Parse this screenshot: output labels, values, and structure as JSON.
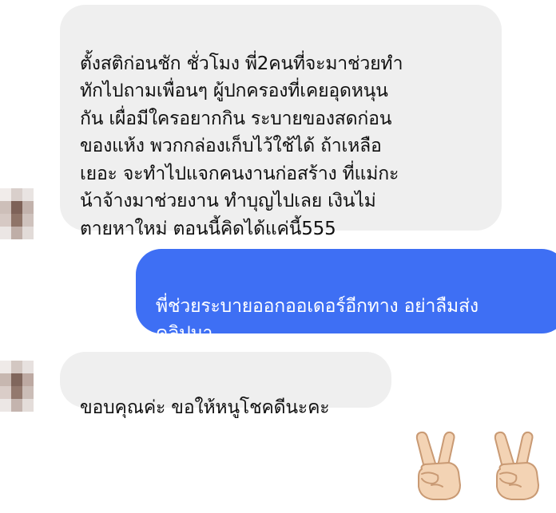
{
  "conversation": {
    "messages": [
      {
        "direction": "incoming",
        "text": "ตั้งสติก่อนชัก ชั่วโมง  พี่2คนที่จะมาช่วยทำ\nทักไปถามเพื่อนๆ ผู้ปกครองที่เคยอุดหนุน\nกัน  เผื่อมีใครอยากกิน  ระบายของสดก่อน\nของแห้ง พวกกล่องเก็บไว้ใช้ได้  ถ้าเหลือ\nเยอะ จะทำไปแจกคนงานก่อสร้าง ที่แม่กะ\nน้าจ้างมาช่วยงาน  ทำบุญไปเลย  เงินไม่\nตายหาใหม่ ตอนนี้คิดได้แค่นี้555"
      },
      {
        "direction": "outgoing",
        "text": "พี่ช่วยระบายออกออเดอร์อีกทาง อย่าลืมส่ง\nคลิปมา"
      },
      {
        "direction": "incoming",
        "text": "ขอบคุณค่ะ  ขอให้หนูโชคดีนะคะ"
      }
    ],
    "reactions": [
      {
        "icon": "victory-hand-icon"
      },
      {
        "icon": "victory-hand-icon"
      }
    ]
  },
  "colors": {
    "incoming_bubble": "#efefef",
    "outgoing_bubble": "#3e6ff4",
    "background": "#ffffff"
  }
}
